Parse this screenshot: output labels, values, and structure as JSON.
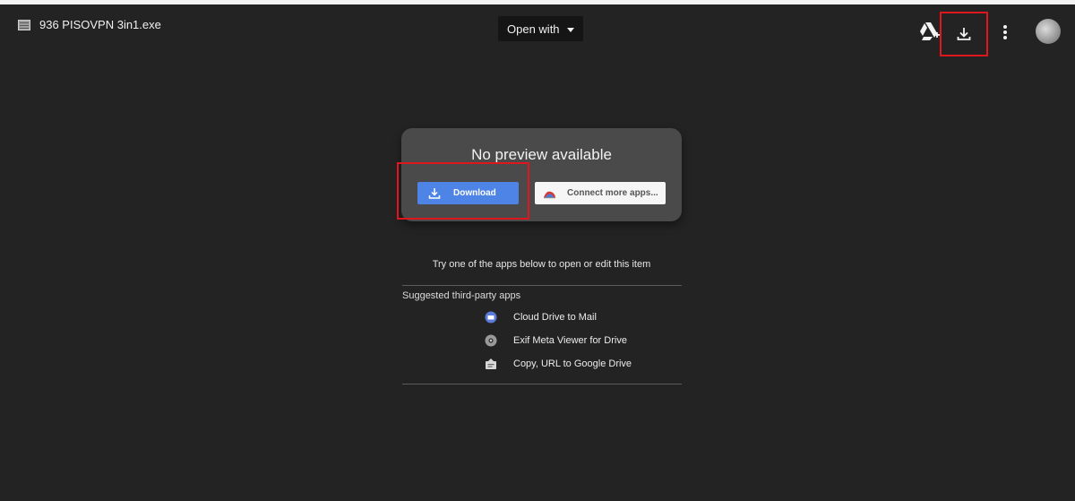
{
  "header": {
    "file_name": "936 PISOVPN 3in1.exe",
    "open_with_label": "Open with"
  },
  "icons": {
    "file": "file-icon",
    "drive_add": "add-to-drive-icon",
    "download": "download-icon",
    "more": "more-vert-icon",
    "avatar": "avatar"
  },
  "preview": {
    "title": "No preview available",
    "download_label": "Download",
    "connect_label": "Connect more apps..."
  },
  "apps": {
    "prompt": "Try one of the apps below to open or edit this item",
    "section_title": "Suggested third-party apps",
    "items": [
      {
        "label": "Cloud Drive to Mail",
        "icon": "mail-app-icon",
        "color": "#5a7bd8"
      },
      {
        "label": "Exif Meta Viewer for Drive",
        "icon": "camera-app-icon",
        "color": "#9a9a9a"
      },
      {
        "label": "Copy, URL to Google Drive",
        "icon": "url-app-icon",
        "color": "#d8d8d8"
      }
    ]
  },
  "colors": {
    "background": "#232323",
    "card": "#4a4a4a",
    "download_button": "#4d84e6",
    "highlight": "#e0161e"
  }
}
